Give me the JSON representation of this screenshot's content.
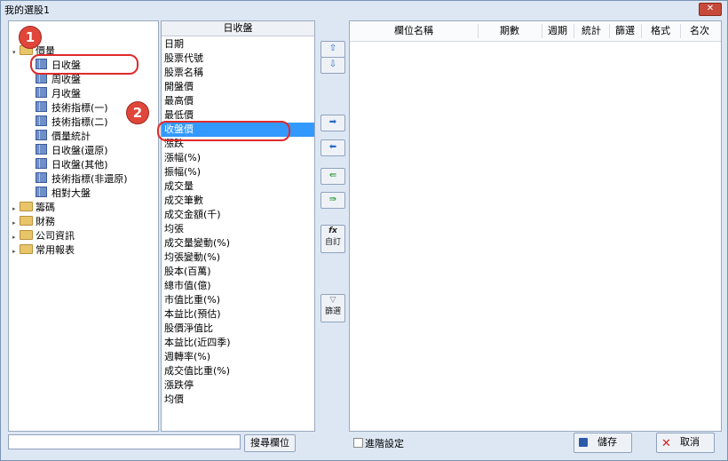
{
  "window": {
    "title": "我的選股1",
    "close_label": "✕"
  },
  "tree": {
    "groups": [
      {
        "label": "價量",
        "expanded": true,
        "children": [
          "日收盤",
          "周收盤",
          "月收盤",
          "技術指標(一)",
          "技術指標(二)",
          "價量統計",
          "日收盤(還原)",
          "日收盤(其他)",
          "技術指標(非還原)",
          "相對大盤"
        ]
      },
      {
        "label": "籌碼",
        "expanded": false
      },
      {
        "label": "財務",
        "expanded": false
      },
      {
        "label": "公司資訊",
        "expanded": false
      },
      {
        "label": "常用報表",
        "expanded": false
      }
    ]
  },
  "fields": {
    "header": "日收盤",
    "items": [
      "日期",
      "股票代號",
      "股票名稱",
      "開盤價",
      "最高價",
      "最低價",
      "收盤價",
      "漲跌",
      "漲幅(%)",
      "振幅(%)",
      "成交量",
      "成交筆數",
      "成交金額(千)",
      "均張",
      "成交量變動(%)",
      "均張變動(%)",
      "股本(百萬)",
      "總市值(億)",
      "市值比重(%)",
      "本益比(預估)",
      "股價淨值比",
      "本益比(近四季)",
      "週轉率(%)",
      "成交值比重(%)",
      "漲跌停",
      "均價"
    ],
    "selected_index": 6
  },
  "middle_buttons": {
    "up": "⇧",
    "down": "⇩",
    "add": "➡",
    "remove": "⬅",
    "add_all": "⇛",
    "remove_all": "⇚",
    "custom_fx": "fx",
    "custom_label": "自訂",
    "filter_label": "篩選"
  },
  "columns": {
    "headers": [
      "欄位名稱",
      "期數",
      "週期",
      "統計",
      "篩選",
      "格式",
      "名次"
    ]
  },
  "footer": {
    "search_placeholder": "",
    "search_button": "搜尋欄位",
    "advanced_label": "進階設定",
    "save_label": "儲存",
    "cancel_label": "取消"
  },
  "annotations": {
    "badge1": "1",
    "badge2": "2"
  },
  "colors": {
    "selection": "#3399ff",
    "badge": "#e0463a",
    "ring": "#e02a2a"
  }
}
